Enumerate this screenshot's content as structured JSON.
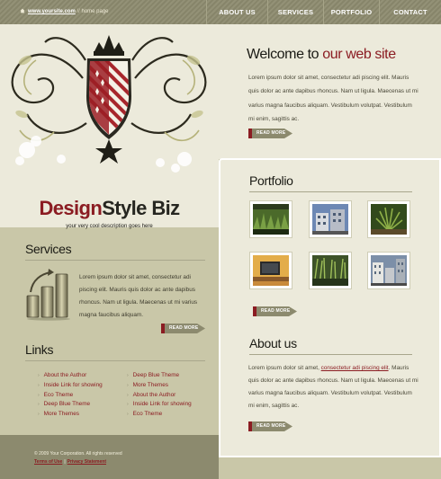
{
  "topbar": {
    "url": "www.yoursite.com",
    "separator": "//",
    "page": "home page"
  },
  "nav": {
    "items": [
      {
        "label": "ABOUT US"
      },
      {
        "label": "SERVICES"
      },
      {
        "label": "PORTFOLIO"
      },
      {
        "label": "CONTACT"
      }
    ]
  },
  "brand": {
    "part1": "Design",
    "part2": "Style Biz",
    "tagline": "your very cool description goes here"
  },
  "welcome": {
    "title_part1": "Welcome to ",
    "title_part2": "our web site",
    "text": "Lorem ipsum dolor sit amet, consectetur adi piscing elit. Mauris quis dolor ac ante dapibus rhoncus. Nam ut ligula. Maecenas ut mi varius magna faucibus aliquam. Vestibulum volutpat. Vestibulum mi enim, sagittis ac.",
    "read_more": "READ MORE"
  },
  "portfolio": {
    "title": "Portfolio",
    "thumbnails": [
      {
        "icon": "grass-photo"
      },
      {
        "icon": "building-photo"
      },
      {
        "icon": "plant-photo"
      },
      {
        "icon": "tv-photo"
      },
      {
        "icon": "reeds-photo"
      },
      {
        "icon": "city-photo"
      }
    ],
    "read_more": "READ MORE"
  },
  "about": {
    "title": "About us",
    "text_before": "Lorem ipsum dolor sit amet, ",
    "link": "consectetur adi piscing elit",
    "text_after": ". Mauris quis dolor ac ante dapibus rhoncus. Nam ut ligula. Maecenas ut mi varius magna faucibus aliquam. Vestibulum volutpat. Vestibulum mi enim, sagittis ac.",
    "read_more": "READ MORE"
  },
  "services": {
    "title": "Services",
    "text": "Lorem ipsum dolor sit amet, consectetur adi piscing elit. Mauris quis dolor ac ante dapibus rhoncus. Nam ut ligula. Maecenas ut mi varius magna faucibus aliquam.",
    "read_more": "READ MORE"
  },
  "links": {
    "title": "Links",
    "column1": [
      {
        "label": "About the Author"
      },
      {
        "label": "Inside Link for showing"
      },
      {
        "label": "Eco Theme"
      },
      {
        "label": "Deep Blue Theme"
      },
      {
        "label": "More Themes"
      }
    ],
    "column2": [
      {
        "label": "Deep Blue Theme"
      },
      {
        "label": "More Themes"
      },
      {
        "label": "About the Author"
      },
      {
        "label": "Inside Link for showing"
      },
      {
        "label": "Eco Theme"
      }
    ]
  },
  "footer": {
    "copyright": "© 2009 Your Corporation. All rights reserved",
    "terms": "Terms of Use",
    "separator": "|",
    "privacy": "Privacy Statement"
  },
  "colors": {
    "accent": "#8b1c22",
    "nav_bg": "#8c8a6e",
    "panel_bg": "#eceadb",
    "page_bg": "#c9c7a8"
  }
}
